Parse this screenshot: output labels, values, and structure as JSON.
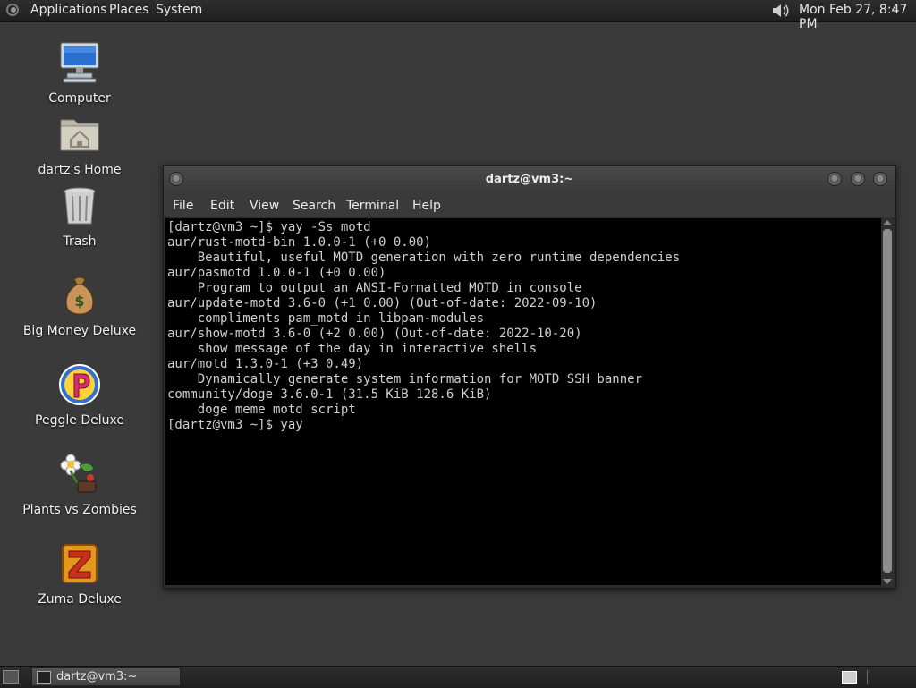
{
  "top_panel": {
    "menus": [
      "Applications",
      "Places",
      "System"
    ],
    "icons": [
      "gnome-logo-icon",
      "speaker-icon"
    ],
    "clock": "Mon Feb 27,  8:47 PM"
  },
  "desktop_icons": [
    {
      "label": "Computer",
      "icon": "computer-icon"
    },
    {
      "label": "dartz's Home",
      "icon": "home-folder-icon"
    },
    {
      "label": "Trash",
      "icon": "trash-icon"
    },
    {
      "label": "Big Money Deluxe",
      "icon": "money-bag-icon"
    },
    {
      "label": "Peggle Deluxe",
      "icon": "peggle-icon"
    },
    {
      "label": "Plants vs Zombies",
      "icon": "flower-icon"
    },
    {
      "label": "Zuma Deluxe",
      "icon": "zuma-icon"
    }
  ],
  "window": {
    "title": "dartz@vm3:~",
    "menu": [
      "File",
      "Edit",
      "View",
      "Search",
      "Terminal",
      "Help"
    ],
    "terminal_lines": [
      "[dartz@vm3 ~]$ yay -Ss motd",
      "aur/rust-motd-bin 1.0.0-1 (+0 0.00)",
      "    Beautiful, useful MOTD generation with zero runtime dependencies",
      "aur/pasmotd 1.0.0-1 (+0 0.00)",
      "    Program to output an ANSI-Formatted MOTD in console",
      "aur/update-motd 3.6-0 (+1 0.00) (Out-of-date: 2022-09-10)",
      "    compliments pam_motd in libpam-modules",
      "aur/show-motd 3.6-0 (+2 0.00) (Out-of-date: 2022-10-20)",
      "    show message of the day in interactive shells",
      "aur/motd 1.3.0-1 (+3 0.49)",
      "    Dynamically generate system information for MOTD SSH banner",
      "community/doge 3.6.0-1 (31.5 KiB 128.6 KiB)",
      "    doge meme motd script",
      "[dartz@vm3 ~]$ yay "
    ]
  },
  "bottom_panel": {
    "task_label": "dartz@vm3:~"
  },
  "colors": {
    "desktop_bg": "#3a3a3a",
    "terminal_bg": "#000000",
    "terminal_fg": "#cfcfcf"
  }
}
